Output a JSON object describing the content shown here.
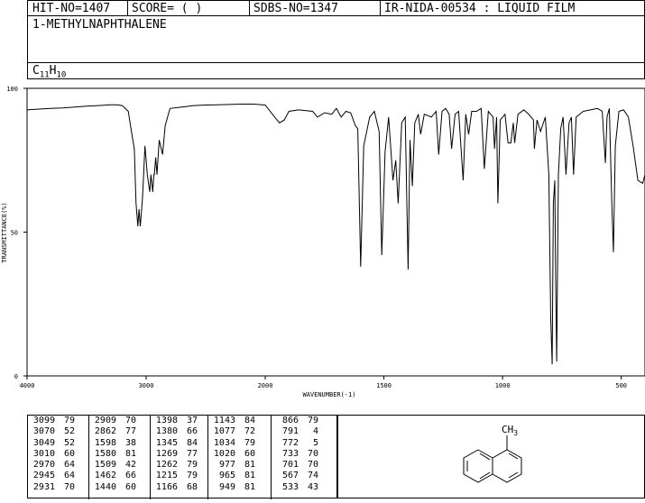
{
  "header": {
    "hit_no": "HIT-NO=1407",
    "score": "SCORE=  (  )",
    "sdbs_no": "SDBS-NO=1347",
    "ir_code": "IR-NIDA-00534 : LIQUID FILM"
  },
  "compound": {
    "name": "1-METHYLNAPHTHALENE",
    "formula_c": "C",
    "formula_c_sub": "11",
    "formula_h": "H",
    "formula_h_sub": "10"
  },
  "structure": {
    "ch3_label": "CH",
    "ch3_sub": "3"
  },
  "chart_data": {
    "type": "line",
    "xlabel": "WAVENUMBER(-1)",
    "ylabel": "TRANSMITTANCE(%)",
    "xlim": [
      4000,
      400
    ],
    "ylim": [
      0,
      100
    ],
    "x_ticks": [
      4000,
      3000,
      2000,
      1500,
      1000,
      500
    ],
    "y_ticks": [
      0,
      50,
      100
    ],
    "x_tick_labels": [
      "4000",
      "3000",
      "2000",
      "1500",
      "1000",
      "500"
    ],
    "y_tick_labels": [
      "0",
      "50",
      "100"
    ],
    "series": [
      {
        "x": [
          4000,
          3900,
          3800,
          3700,
          3600,
          3500,
          3400,
          3300,
          3250,
          3200,
          3150,
          3120,
          3099,
          3085,
          3070,
          3060,
          3049,
          3030,
          3010,
          2990,
          2970,
          2960,
          2945,
          2935,
          2931,
          2920,
          2909,
          2890,
          2862,
          2840,
          2800,
          2700,
          2600,
          2500,
          2400,
          2300,
          2200,
          2100,
          2000,
          1960,
          1940,
          1920,
          1900,
          1860,
          1800,
          1780,
          1750,
          1720,
          1700,
          1680,
          1660,
          1640,
          1620,
          1610,
          1598,
          1585,
          1560,
          1540,
          1520,
          1509,
          1495,
          1480,
          1462,
          1450,
          1440,
          1425,
          1410,
          1398,
          1390,
          1380,
          1370,
          1355,
          1345,
          1330,
          1300,
          1280,
          1269,
          1255,
          1240,
          1225,
          1215,
          1200,
          1185,
          1166,
          1155,
          1143,
          1130,
          1110,
          1090,
          1077,
          1060,
          1040,
          1034,
          1025,
          1020,
          1010,
          990,
          977,
          965,
          955,
          949,
          935,
          910,
          890,
          870,
          866,
          855,
          840,
          820,
          805,
          797,
          791,
          786,
          780,
          776,
          772,
          765,
          755,
          745,
          733,
          720,
          710,
          701,
          690,
          660,
          630,
          600,
          580,
          567,
          560,
          550,
          540,
          533,
          525,
          510,
          490,
          470,
          450,
          430,
          410,
          400
        ],
        "y": [
          92.5,
          92.8,
          93.0,
          93.2,
          93.5,
          93.8,
          94.0,
          94.3,
          94.3,
          94.0,
          92.0,
          84.0,
          79.0,
          60.0,
          52.0,
          58.0,
          52.0,
          62.0,
          80.0,
          70.0,
          64.0,
          70.0,
          64.0,
          70.0,
          70.0,
          76.0,
          70.0,
          82.0,
          77.0,
          87.0,
          93.0,
          93.5,
          94.0,
          94.2,
          94.3,
          94.4,
          94.5,
          94.5,
          94.2,
          90.0,
          88.0,
          89.0,
          92.0,
          92.5,
          92.0,
          90.0,
          91.5,
          91.0,
          93.0,
          90.0,
          92.0,
          91.5,
          87.0,
          86.0,
          38.0,
          80.0,
          90.0,
          92.0,
          85.0,
          42.0,
          78.0,
          90.0,
          68.0,
          75.0,
          60.0,
          88.0,
          90.0,
          37.0,
          82.0,
          66.0,
          88.0,
          91.0,
          84.0,
          91.0,
          90.0,
          92.0,
          77.0,
          92.0,
          93.0,
          91.0,
          79.0,
          91.0,
          92.0,
          68.0,
          91.0,
          84.0,
          92.0,
          92.0,
          93.0,
          72.0,
          92.0,
          90.0,
          79.0,
          90.0,
          60.0,
          89.0,
          91.0,
          81.0,
          81.0,
          88.0,
          81.0,
          91.0,
          92.5,
          91.0,
          89.0,
          79.0,
          89.0,
          85.0,
          90.0,
          70.0,
          20.0,
          4.0,
          60.0,
          68.0,
          30.0,
          5.0,
          70.0,
          86.0,
          90.0,
          70.0,
          88.0,
          90.0,
          70.0,
          90.0,
          92.0,
          92.5,
          93.0,
          92.0,
          74.0,
          90.0,
          93.0,
          60.0,
          43.0,
          80.0,
          92.0,
          92.5,
          90.0,
          80.0,
          68.0,
          67.0,
          70.0
        ]
      }
    ]
  },
  "peak_table": [
    [
      [
        "3099",
        "79"
      ],
      [
        "3070",
        "52"
      ],
      [
        "3049",
        "52"
      ],
      [
        "3010",
        "60"
      ],
      [
        "2970",
        "64"
      ],
      [
        "2945",
        "64"
      ],
      [
        "2931",
        "70"
      ]
    ],
    [
      [
        "2909",
        "70"
      ],
      [
        "2862",
        "77"
      ],
      [
        "1598",
        "38"
      ],
      [
        "1580",
        "81"
      ],
      [
        "1509",
        "42"
      ],
      [
        "1462",
        "66"
      ],
      [
        "1440",
        "60"
      ]
    ],
    [
      [
        "1398",
        "37"
      ],
      [
        "1380",
        "66"
      ],
      [
        "1345",
        "84"
      ],
      [
        "1269",
        "77"
      ],
      [
        "1262",
        "79"
      ],
      [
        "1215",
        "79"
      ],
      [
        "1166",
        "68"
      ]
    ],
    [
      [
        "1143",
        "84"
      ],
      [
        "1077",
        "72"
      ],
      [
        "1034",
        "79"
      ],
      [
        "1020",
        "60"
      ],
      [
        "977",
        "81"
      ],
      [
        "965",
        "81"
      ],
      [
        "949",
        "81"
      ]
    ],
    [
      [
        "866",
        "79"
      ],
      [
        "791",
        "4"
      ],
      [
        "772",
        "5"
      ],
      [
        "733",
        "70"
      ],
      [
        "701",
        "70"
      ],
      [
        "567",
        "74"
      ],
      [
        "533",
        "43"
      ]
    ]
  ]
}
